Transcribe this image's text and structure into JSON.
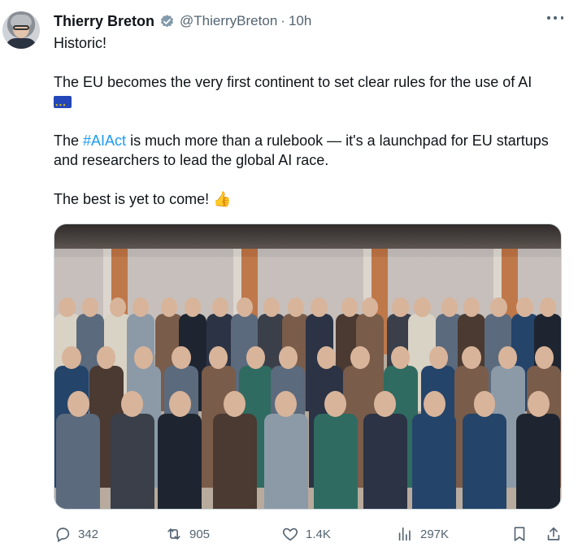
{
  "author": {
    "name": "Thierry Breton",
    "handle": "@ThierryBreton",
    "separator": "·",
    "time": "10h"
  },
  "tweet": {
    "line1": "Historic!",
    "line2": "The EU becomes the very first continent to set clear rules for the use of AI",
    "flag_emoji": "eu-flag",
    "line3_prefix": "The ",
    "hashtag": "#AIAct",
    "line3_suffix": " is much more than a rulebook — it's a launchpad for EU startups and researchers to lead the global AI race.",
    "line4": "The best is yet to come!",
    "thumb_emoji": "👍"
  },
  "actions": {
    "replies": "342",
    "reposts": "905",
    "likes": "1.4K",
    "views": "297K"
  },
  "colors": {
    "link": "#1d9bf0",
    "verified": "#829aab",
    "secondary_text": "#536471"
  }
}
